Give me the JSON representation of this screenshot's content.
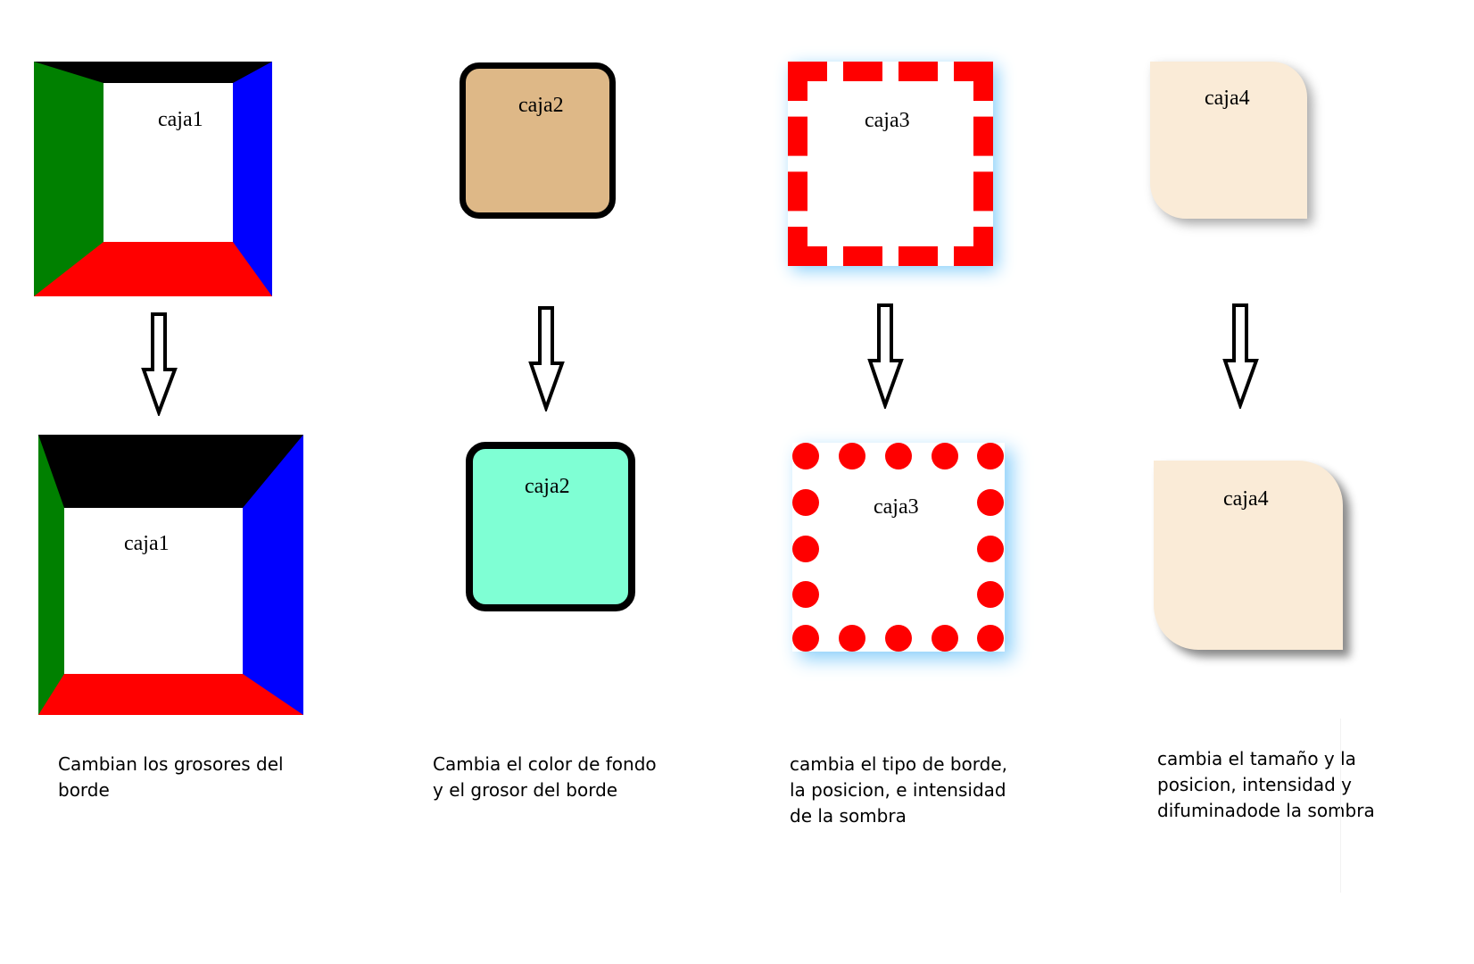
{
  "boxes": {
    "caja1_top": {
      "label": "caja1"
    },
    "caja1_bottom": {
      "label": "caja1"
    },
    "caja2_top": {
      "label": "caja2"
    },
    "caja2_bottom": {
      "label": "caja2"
    },
    "caja3_top": {
      "label": "caja3"
    },
    "caja3_bottom": {
      "label": "caja3"
    },
    "caja4_top": {
      "label": "caja4"
    },
    "caja4_bottom": {
      "label": "caja4"
    }
  },
  "captions": {
    "col1": [
      "Cambian los grosores del",
      "borde"
    ],
    "col2": [
      "Cambia el color de fondo",
      "y el grosor del borde"
    ],
    "col3": [
      "cambia el tipo de borde,",
      "la posicion, e intensidad",
      "de la sombra"
    ],
    "col4": [
      "cambia el tamaño y la",
      "posicion, intensidad y",
      "difuminadode la sombra"
    ]
  },
  "colors": {
    "caja1_border_top": "#000000",
    "caja1_border_right": "#0000ff",
    "caja1_border_bottom": "#ff0000",
    "caja1_border_left": "#008000",
    "caja2_top_background": "#deb887",
    "caja2_bottom_background": "#7fffd4",
    "caja3_border": "#ff0000",
    "caja3_shadow": "#87cefa",
    "caja4_background": "#faebd7"
  },
  "icons": {
    "arrow": "down-arrow-icon"
  }
}
